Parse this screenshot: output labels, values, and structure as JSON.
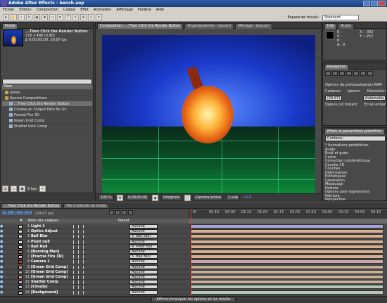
{
  "title": "Adobe After Effects - bench.aep",
  "menu": [
    "Fichier",
    "Edition",
    "Composition",
    "Calque",
    "Effet",
    "Animation",
    "Affichage",
    "Fenêtre",
    "Aide"
  ],
  "workspace": {
    "label": "Espace de travail :",
    "value": "Standard"
  },
  "project": {
    "tab": "Projet",
    "comp_name": "...Then Click the Render Button",
    "dims": "720 x 486 (0,90)",
    "duration": "Δ 0;00;05;00, 29,97 ips",
    "search": "",
    "col_name": "Nom",
    "items": [
      {
        "label": "Solids",
        "kind": "folder"
      },
      {
        "label": "Source Compositions",
        "kind": "folder"
      },
      {
        "label": "...Then Click the Render Button",
        "kind": "comp",
        "selected": true
      },
      {
        "label": "Choose an Output Path for Us",
        "kind": "comp"
      },
      {
        "label": "Fractal Fire 3D",
        "kind": "comp"
      },
      {
        "label": "Green Grid Comp",
        "kind": "comp"
      },
      {
        "label": "Shatter Grid Comp",
        "kind": "comp"
      }
    ],
    "footer": "8 bpc"
  },
  "viewer": {
    "tabs": [
      "Composition : ...Then Click the Render Button",
      "Organigramme : (aucun)",
      "Métrage : (aucun)"
    ],
    "zoom": "100 %",
    "timecode": "0;00;00;00",
    "resolution": "Intégrale",
    "camera": "Caméra active",
    "views": "1 vue",
    "bit": "+0,0"
  },
  "info": {
    "tab1": "Info",
    "tab2": "Audio",
    "r": "R :",
    "g": "V :",
    "b": "B :",
    "a": "A : 0",
    "x": "X : -302",
    "y": "Y : -252"
  },
  "navigation": {
    "tab": "Navigation",
    "options_label": "Options de prévisualisation RAM",
    "rate_label": "Cadence",
    "rate_value": "(29,97)",
    "skip_label": "Ignorer",
    "res_label": "Résolution",
    "res_value": "Automatiq",
    "from_current": "Depuis cet instant",
    "fullscreen": "Ecran entier"
  },
  "effects": {
    "tab": "Effets et paramètres prédéfinis",
    "search_label": "Contenu :",
    "items": [
      "* Animations prédéfinies",
      "Audio",
      "Bruit et grain",
      "Cache",
      "Correction colorimétrique",
      "Couche 3D",
      "Couches",
      "Déformation",
      "Esthétiques",
      "Génération",
      "Masquage",
      "Netteté",
      "Options pour expressions",
      "Peinture",
      "Perspective"
    ]
  },
  "timeline": {
    "tabs": [
      "...Then Click the Render Button",
      "File d'attente de rendu"
    ],
    "timecode": "0;00;00;00",
    "fps": "(29,97 ips)",
    "col_num": "#",
    "col_name": "Nom des calques",
    "col_parent": "Parent",
    "ruler": [
      "0f",
      "00:15",
      "00:30",
      "01:15",
      "01:00",
      "01:15",
      "02:00",
      "02:15",
      "03:00",
      "03:15",
      "04:00",
      "04:15"
    ],
    "layers": [
      {
        "num": "1",
        "name": "Light 1",
        "color": "#d9d9a0",
        "parent": "Aucune",
        "bar": "#a9a0d8"
      },
      {
        "num": "2",
        "name": "Optics Adjust",
        "color": "#e8e8e8",
        "parent": "Aucune",
        "bar": "#d8b090"
      },
      {
        "num": "3",
        "name": "Ball Blur",
        "color": "#e8e8e8",
        "parent": "5. Ball Null",
        "bar": "#d8b090"
      },
      {
        "num": "4",
        "name": "Pivot null",
        "color": "#e8e8e8",
        "parent": "Aucune",
        "bar": "#d8b090"
      },
      {
        "num": "5",
        "name": "Ball Null",
        "color": "#e8e8e8",
        "parent": "4. Pivot null",
        "bar": "#d8b090"
      },
      {
        "num": "6",
        "name": "[Burning Man]",
        "color": "#c87840",
        "parent": "Aucune",
        "bar": "#d8b090"
      },
      {
        "num": "7",
        "name": "[Fractal Fire 3D]",
        "color": "#d8b8d8",
        "parent": "5. Ball Null",
        "bar": "#d8b090"
      },
      {
        "num": "8",
        "name": "Camera 1",
        "color": "#d84040",
        "parent": "Aucune",
        "bar": "#c8a8a8"
      },
      {
        "num": "9",
        "name": "[Green Grid Comp]",
        "color": "#d8a8a8",
        "parent": "Aucune",
        "bar": "#c8b098"
      },
      {
        "num": "10",
        "name": "[Green Grid Comp]",
        "color": "#d8a8a8",
        "parent": "Aucune",
        "bar": "#c8b098"
      },
      {
        "num": "11",
        "name": "[Green Grid Comp]",
        "color": "#d8a8a8",
        "parent": "Aucune",
        "bar": "#c8b098"
      },
      {
        "num": "12",
        "name": "Shatter Comp",
        "color": "#d8a8a8",
        "parent": "Aucune",
        "bar": "#c8b098"
      },
      {
        "num": "13",
        "name": "[Clouds]",
        "color": "#a8c8d8",
        "parent": "Aucune",
        "bar": "#b8c8b8"
      },
      {
        "num": "14",
        "name": "[Background]",
        "color": "#a8c8d8",
        "parent": "Aucune",
        "bar": "#b8c8b8"
      }
    ],
    "footer": "Afficher/masquer les options et les modes"
  }
}
